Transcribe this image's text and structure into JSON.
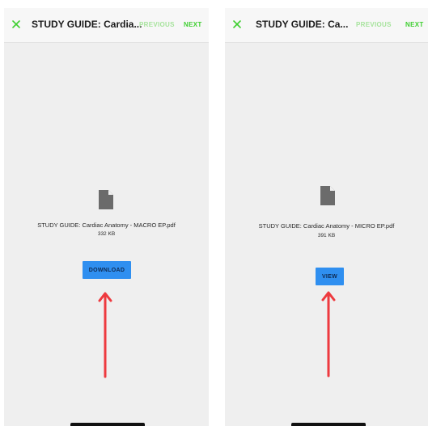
{
  "colors": {
    "accent_green": "#3fcf31",
    "disabled_green": "#a6e39c",
    "button_blue": "#2f8ff0",
    "arrow_red": "#ee3a3f",
    "file_icon_gray": "#6b6b6b"
  },
  "left_screen": {
    "close_icon": "close-icon",
    "title": "STUDY GUIDE: Cardia...",
    "previous_label": "PREVIOUS",
    "next_label": "NEXT",
    "file_icon": "file-icon",
    "file_name": "STUDY GUIDE: Cardiac Anatomy - MACRO EP.pdf",
    "file_size": "332 KB",
    "action_label": "DOWNLOAD",
    "annotation_icon": "arrow-up-icon"
  },
  "right_screen": {
    "close_icon": "close-icon",
    "title": "STUDY GUIDE: Ca...",
    "previous_label": "PREVIOUS",
    "next_label": "NEXT",
    "file_icon": "file-icon",
    "file_name": "STUDY GUIDE: Cardiac Anatomy - MICRO EP.pdf",
    "file_size": "391 KB",
    "action_label": "VIEW",
    "annotation_icon": "arrow-up-icon"
  }
}
